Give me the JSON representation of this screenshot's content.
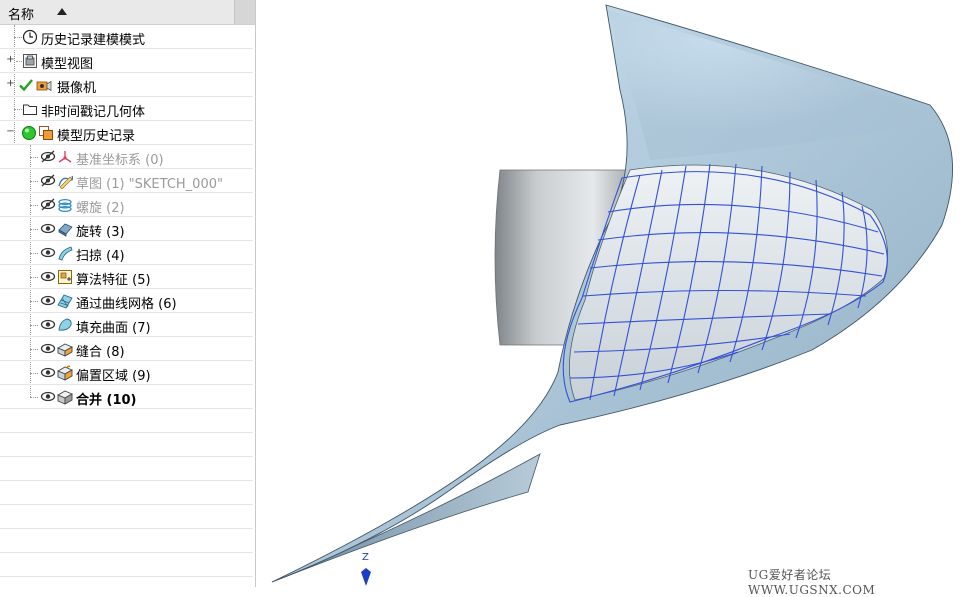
{
  "navigator": {
    "column_header": "名称",
    "nodes": [
      {
        "label": "历史记录建模模式",
        "style": "normal",
        "icon": "clock-icon"
      },
      {
        "label": "模型视图",
        "style": "normal",
        "icon": "model-view-icon",
        "expander": "+"
      },
      {
        "label": "摄像机",
        "style": "normal",
        "icon": "camera-icon",
        "expander": "+"
      },
      {
        "label": "非时间戳记几何体",
        "style": "normal",
        "icon": "folder-icon"
      },
      {
        "label": "模型历史记录",
        "style": "normal",
        "icon": "model-history-icon",
        "expander": "−"
      },
      {
        "label": "基准坐标系 (0)",
        "style": "dim",
        "icon": "datum-csys-icon",
        "visibility": "hidden"
      },
      {
        "label": "草图 (1) \"SKETCH_000\"",
        "style": "dim",
        "icon": "sketch-icon",
        "visibility": "hidden"
      },
      {
        "label": "螺旋 (2)",
        "style": "dim",
        "icon": "helix-icon",
        "visibility": "hidden"
      },
      {
        "label": "旋转 (3)",
        "style": "normal",
        "icon": "revolve-icon",
        "visibility": "visible"
      },
      {
        "label": "扫掠 (4)",
        "style": "normal",
        "icon": "swept-icon",
        "visibility": "visible"
      },
      {
        "label": "算法特征 (5)",
        "style": "normal",
        "icon": "algorithmic-feature-icon",
        "visibility": "visible"
      },
      {
        "label": "通过曲线网格 (6)",
        "style": "normal",
        "icon": "through-curve-mesh-icon",
        "visibility": "visible"
      },
      {
        "label": "填充曲面 (7)",
        "style": "normal",
        "icon": "fill-surface-icon",
        "visibility": "visible"
      },
      {
        "label": "缝合 (8)",
        "style": "normal",
        "icon": "sew-icon",
        "visibility": "visible"
      },
      {
        "label": "偏置区域 (9)",
        "style": "normal",
        "icon": "offset-region-icon",
        "visibility": "visible"
      },
      {
        "label": "合并 (10)",
        "style": "bold",
        "icon": "unite-icon",
        "visibility": "visible"
      }
    ]
  },
  "viewport": {
    "triad_axis_label": "Z",
    "watermark": "UG爱好者论坛 WWW.UGSNX.COM",
    "colors": {
      "surface": "#a9c3d6",
      "surface_highlight": "#dbe9f3",
      "mesh_lines": "#3350d6",
      "triad": "#1b3fc4"
    }
  }
}
